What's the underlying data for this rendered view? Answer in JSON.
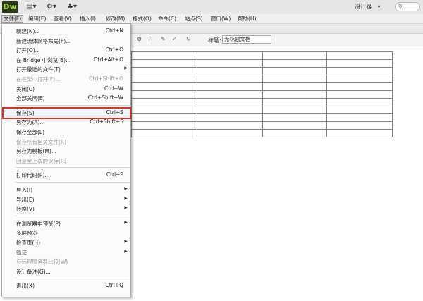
{
  "app": {
    "logo": "Dw",
    "workspace": "设计器",
    "workspace_arrow": "▾",
    "search_icon": "search-icon"
  },
  "titlebar_icons": [
    "▤▾",
    "⚙▾",
    "♣▾"
  ],
  "menubar": [
    "文件(F)",
    "编辑(E)",
    "查看(V)",
    "插入(I)",
    "修改(M)",
    "格式(O)",
    "命令(C)",
    "站点(S)",
    "窗口(W)",
    "帮助(H)"
  ],
  "doc_toolbar": {
    "title_label": "标题:",
    "title_value": "无标题文档"
  },
  "file_menu": [
    {
      "label": "新建(N)...",
      "shortcut": "Ctrl+N"
    },
    {
      "label": "新建流体网格布局(F)...",
      "shortcut": ""
    },
    {
      "label": "打开(O)...",
      "shortcut": "Ctrl+O"
    },
    {
      "label": "在 Bridge 中浏览(B)...",
      "shortcut": "Ctrl+Alt+O"
    },
    {
      "label": "打开最近的文件(T)",
      "shortcut": "",
      "submenu": true
    },
    {
      "label": "在框架中打开(F)...",
      "shortcut": "Ctrl+Shift+O",
      "disabled": true
    },
    {
      "label": "关闭(C)",
      "shortcut": "Ctrl+W"
    },
    {
      "label": "全部关闭(E)",
      "shortcut": "Ctrl+Shift+W"
    },
    {
      "sep": true
    },
    {
      "label": "保存(S)",
      "shortcut": "Ctrl+S",
      "highlight": true
    },
    {
      "label": "另存为(A)...",
      "shortcut": "Ctrl+Shift+S"
    },
    {
      "label": "保存全部(L)",
      "shortcut": ""
    },
    {
      "label": "保存所有相关文件(R)",
      "shortcut": "",
      "disabled": true
    },
    {
      "label": "另存为模板(M)...",
      "shortcut": ""
    },
    {
      "label": "回复至上次的保存(R)",
      "shortcut": "",
      "disabled": true
    },
    {
      "sep": true
    },
    {
      "label": "打印代码(P)...",
      "shortcut": "Ctrl+P"
    },
    {
      "sep": true
    },
    {
      "label": "导入(I)",
      "shortcut": "",
      "submenu": true
    },
    {
      "label": "导出(E)",
      "shortcut": "",
      "submenu": true
    },
    {
      "label": "转换(V)",
      "shortcut": "",
      "submenu": true
    },
    {
      "sep": true
    },
    {
      "label": "在浏览器中预览(P)",
      "shortcut": "",
      "submenu": true
    },
    {
      "label": "多屏预览",
      "shortcut": ""
    },
    {
      "label": "检查页(H)",
      "shortcut": "",
      "submenu": true
    },
    {
      "label": "验证",
      "shortcut": "",
      "submenu": true
    },
    {
      "label": "与远程服务器比较(W)",
      "shortcut": "",
      "disabled": true
    },
    {
      "label": "设计备注(G)...",
      "shortcut": ""
    },
    {
      "sep": true
    },
    {
      "label": "退出(X)",
      "shortcut": "Ctrl+Q"
    }
  ]
}
